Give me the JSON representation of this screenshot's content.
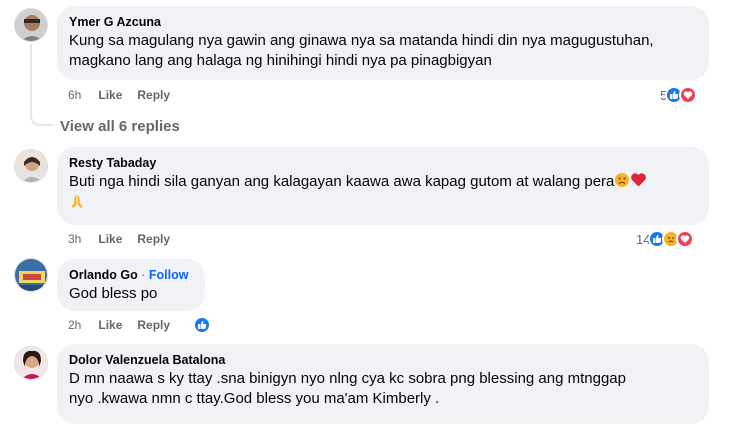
{
  "comments": [
    {
      "author": "Ymer G Azcuna",
      "text_line1": "Kung sa magulang nya gawin ang ginawa nya sa matanda hindi din nya magugustuhan,",
      "text_line2": "magkano lang ang halaga ng hinihingi hindi nya pa pinagbigyan",
      "time": "6h",
      "like_label": "Like",
      "reply_label": "Reply",
      "reaction_count": "5",
      "reactions": [
        "like-icon",
        "love-icon"
      ]
    },
    {
      "author": "Resty Tabaday",
      "text_line1": "Buti nga hindi sila ganyan ang kalagayan kaawa awa kapag gutom at walang pera",
      "text_line2": "",
      "time": "3h",
      "like_label": "Like",
      "reply_label": "Reply",
      "reaction_count": "14",
      "reactions": [
        "like-icon",
        "sad-icon",
        "love-icon"
      ]
    },
    {
      "author": "Orlando Go",
      "follow_label": "Follow",
      "text_line1": "God bless po",
      "time": "2h",
      "like_label": "Like",
      "reply_label": "Reply",
      "reactions": [
        "like-icon"
      ]
    },
    {
      "author": "Dolor Valenzuela Batalona",
      "text_line1": "D mn naawa s ky ttay .sna binigyn nyo nlng cya kc sobra png blessing ang mtnggap",
      "text_line2": "nyo .kwawa nmn c ttay.God bless you ma'am Kimberly ."
    }
  ],
  "view_replies": "View all 6 replies",
  "separator": "·",
  "colors": {
    "bubble": "#f0f2f5",
    "meta": "#65676b",
    "link": "#0866ff",
    "like": "#1877f2",
    "love": "#f33e58",
    "sad": "#f7b125"
  }
}
